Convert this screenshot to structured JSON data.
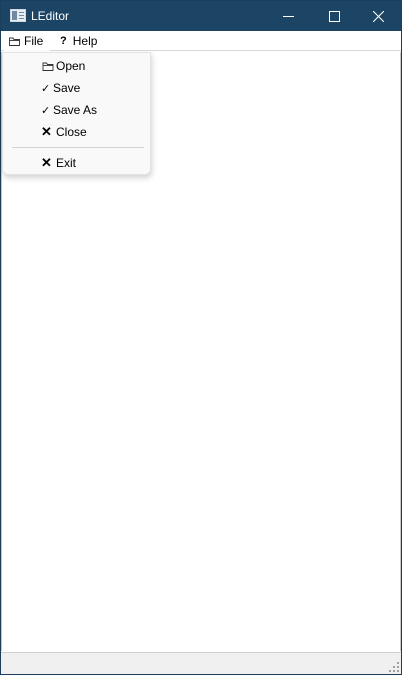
{
  "window": {
    "title": "LEditor",
    "controls": [
      "minimize-icon",
      "maximize-icon",
      "close-icon"
    ],
    "titlebar_color": "#1c4465"
  },
  "menubar": {
    "file": {
      "label": "File",
      "icon": "folder-icon"
    },
    "help": {
      "label": "Help",
      "icon": "question-icon",
      "glyph": "?"
    }
  },
  "file_menu": {
    "open": {
      "label": "Open",
      "icon": "folder-icon"
    },
    "save": {
      "label": "Save",
      "glyph": "✓",
      "icon": "check-icon"
    },
    "save_as": {
      "label": "Save As",
      "glyph": "✓",
      "icon": "check-icon"
    },
    "close": {
      "label": "Close",
      "glyph": "✕",
      "icon": "x-icon"
    },
    "exit": {
      "label": "Exit",
      "glyph": "✕",
      "icon": "x-icon"
    }
  },
  "editor": {
    "content": ""
  },
  "statusbar": {
    "text": ""
  }
}
